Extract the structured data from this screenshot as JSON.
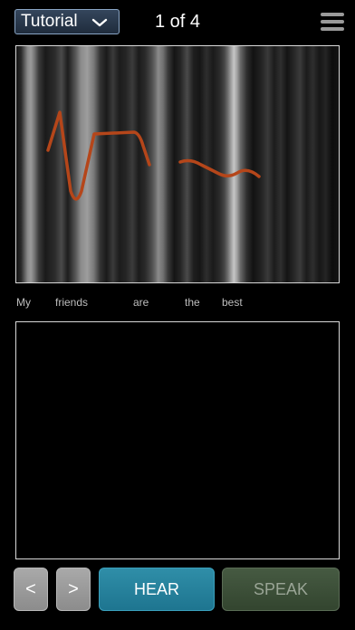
{
  "header": {
    "dropdown_value": "Tutorial",
    "page_indicator": "1 of 4",
    "menu_icon": "hamburger-menu-icon"
  },
  "spectrogram": {
    "pitch_curve_color": "#b5461a"
  },
  "words": [
    "My",
    "friends",
    "are",
    "the",
    "best"
  ],
  "controls": {
    "prev_label": "<",
    "next_label": ">",
    "hear_label": "HEAR",
    "speak_label": "SPEAK"
  },
  "colors": {
    "hear_button": "#2a859f",
    "speak_button": "#3e5239",
    "speak_text": "#9aa596"
  }
}
